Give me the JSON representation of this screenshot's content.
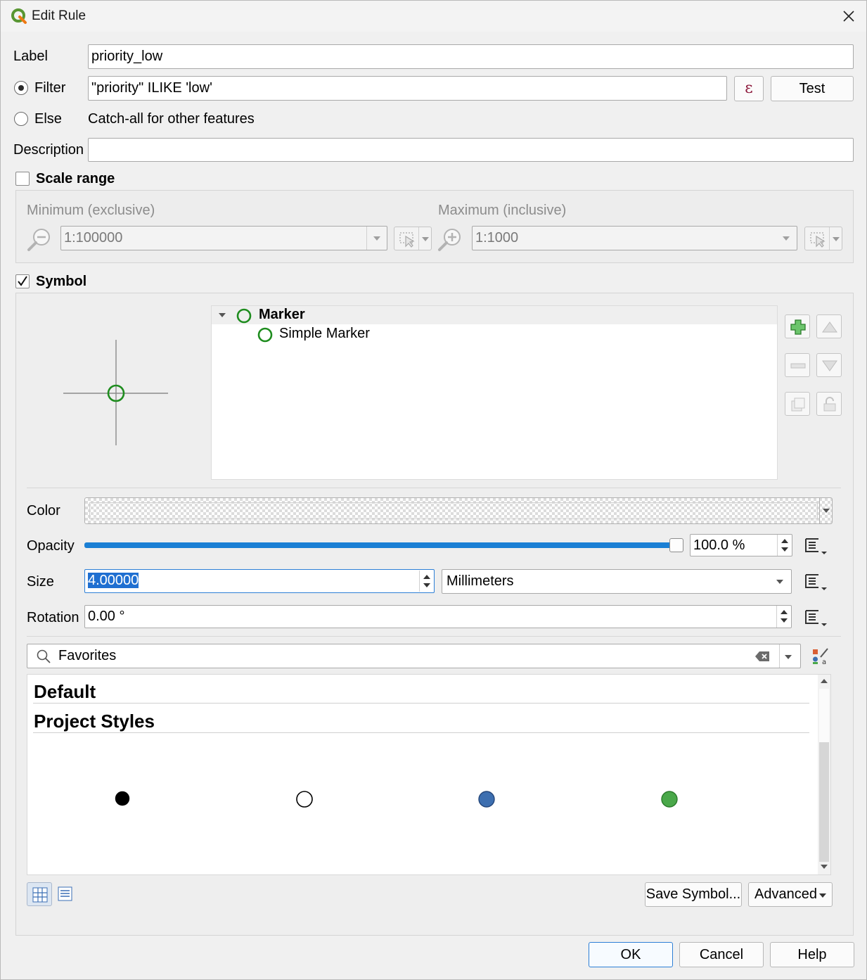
{
  "window": {
    "title": "Edit Rule",
    "icons": {
      "app": "qgis-logo-icon",
      "close": "close-icon"
    }
  },
  "rule": {
    "label_caption": "Label",
    "label_value": "priority_low",
    "filter_caption": "Filter",
    "filter_value": "\"priority\" ILIKE 'low'",
    "expression_button": "ε",
    "test_button": "Test",
    "else_caption": "Else",
    "else_text": "Catch-all for other features",
    "description_caption": "Description",
    "description_value": ""
  },
  "scale": {
    "title": "Scale range",
    "enabled": false,
    "min_label": "Minimum (exclusive)",
    "min_value": "1:100000",
    "max_label": "Maximum (inclusive)",
    "max_value": "1:1000"
  },
  "symbol": {
    "title": "Symbol",
    "enabled": true,
    "tree_root": "Marker",
    "tree_child": "Simple Marker",
    "color_label": "Color",
    "opacity_label": "Opacity",
    "opacity_value": "100.0 %",
    "opacity_fraction": 1.0,
    "size_label": "Size",
    "size_value": "4.00000",
    "size_unit": "Millimeters",
    "rotation_label": "Rotation",
    "rotation_value": "0.00 °",
    "accent_color": "#1e8c1e"
  },
  "library": {
    "search_value": "Favorites",
    "group_default": "Default",
    "group_project": "Project Styles",
    "swatches": [
      {
        "name": "black-dot",
        "fill": "#000000",
        "stroke": "#000000"
      },
      {
        "name": "white-dot",
        "fill": "#ffffff",
        "stroke": "#000000"
      },
      {
        "name": "blue-dot",
        "fill": "#3d6fb0",
        "stroke": "#24467a"
      },
      {
        "name": "green-dot",
        "fill": "#4aa84a",
        "stroke": "#2b7a2b"
      }
    ],
    "save_button": "Save Symbol...",
    "advanced_button": "Advanced"
  },
  "footer": {
    "ok": "OK",
    "cancel": "Cancel",
    "help": "Help"
  }
}
